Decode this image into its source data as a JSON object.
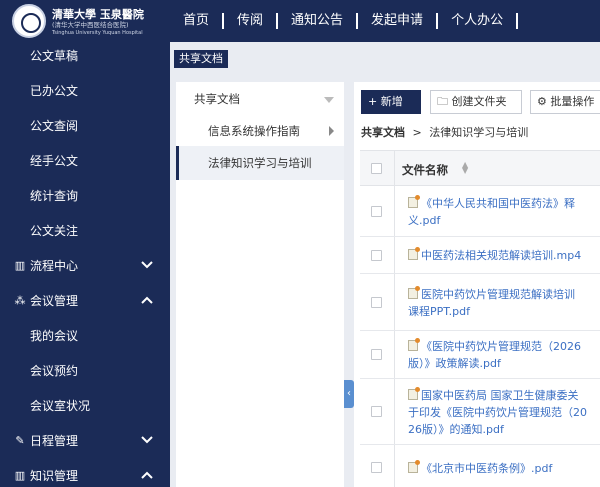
{
  "logo": {
    "name": "清華大學 玉泉醫院",
    "subtitle_cn": "(清华大学中西医结合医院)",
    "subtitle_en": "Tsinghua University Yuquan Hospital"
  },
  "nav": [
    "首页",
    "传阅",
    "通知公告",
    "发起申请",
    "个人办公"
  ],
  "sidebar": {
    "items": [
      {
        "label": "公文草稿",
        "type": "sub"
      },
      {
        "label": "已办公文",
        "type": "sub"
      },
      {
        "label": "公文查阅",
        "type": "sub"
      },
      {
        "label": "经手公文",
        "type": "sub"
      },
      {
        "label": "统计查询",
        "type": "sub"
      },
      {
        "label": "公文关注",
        "type": "sub"
      },
      {
        "label": "流程中心",
        "type": "group",
        "icon": "flow-icon",
        "expanded": false
      },
      {
        "label": "会议管理",
        "type": "group",
        "icon": "org-icon",
        "expanded": true
      },
      {
        "label": "我的会议",
        "type": "sub"
      },
      {
        "label": "会议预约",
        "type": "sub"
      },
      {
        "label": "会议室状况",
        "type": "sub"
      },
      {
        "label": "日程管理",
        "type": "group",
        "icon": "edit-icon",
        "expanded": false
      },
      {
        "label": "知识管理",
        "type": "group",
        "icon": "flow-icon",
        "expanded": true
      }
    ]
  },
  "breadcrumb_tag": "共享文档",
  "tree": {
    "root": "共享文档",
    "children": [
      "信息系统操作指南",
      "法律知识学习与培训"
    ],
    "active_index": 1
  },
  "toolbar": {
    "add": "+ 新增",
    "create_folder": "创建文件夹",
    "batch": "批量操作"
  },
  "path": {
    "root": "共享文档",
    "sep": ">",
    "current": "法律知识学习与培训"
  },
  "table": {
    "header": "文件名称",
    "rows": [
      {
        "name": "《中华人民共和国中医药法》释义.pdf",
        "lines": [
          "《中华人民共和国中医药法》释",
          "义.pdf"
        ]
      },
      {
        "name": "中医药法相关规范解读培训.mp4",
        "lines": [
          "中医药法相关规范解读培训.mp4"
        ]
      },
      {
        "name": "医院中药饮片管理规范解读培训课程PPT.pdf",
        "lines": [
          "医院中药饮片管理规范解读培训",
          "课程PPT.pdf"
        ]
      },
      {
        "name": "《医院中药饮片管理规范（2026版）》政策解读.pdf",
        "lines": [
          "《医院中药饮片管理规范（2026",
          "版）》政策解读.pdf"
        ]
      },
      {
        "name": "国家中医药局 国家卫生健康委关于印发《医院中药饮片管理规范（2026版）》的通知.pdf",
        "lines": [
          "国家中医药局 国家卫生健康委关",
          "于印发《医院中药饮片管理规范（20",
          "26版）》的通知.pdf"
        ]
      },
      {
        "name": "《北京市中医药条例》.pdf",
        "lines": [
          "《北京市中医药条例》.pdf"
        ]
      }
    ]
  },
  "colors": {
    "navy": "#1b2b57",
    "link": "#3b6fc3",
    "panel_bg": "#e9ecf2"
  }
}
